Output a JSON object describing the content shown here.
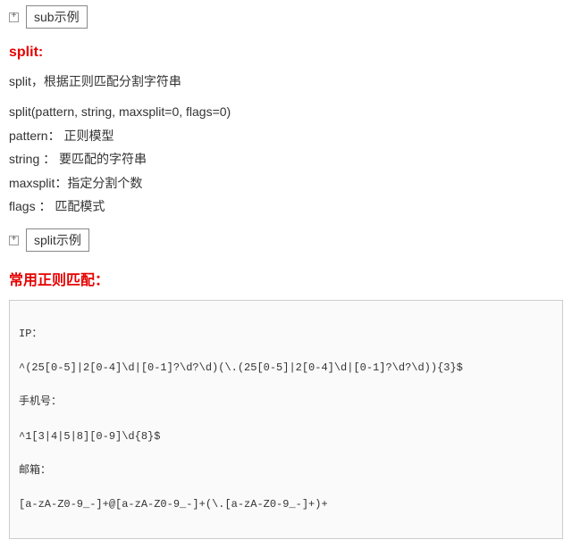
{
  "expand1": {
    "label": "sub示例"
  },
  "split": {
    "title": "split:",
    "desc": "split，根据正则匹配分割字符串",
    "signature": "split(pattern, string, maxsplit=0, flags=0)",
    "params": [
      "pattern： 正则模型",
      "string ： 要匹配的字符串",
      "maxsplit：指定分割个数",
      "flags  ： 匹配模式"
    ]
  },
  "expand2": {
    "label": "split示例"
  },
  "common": {
    "title": "常用正则匹配：",
    "lines": [
      "IP：",
      "^(25[0-5]|2[0-4]\\d|[0-1]?\\d?\\d)(\\.(25[0-5]|2[0-4]\\d|[0-1]?\\d?\\d)){3}$",
      "手机号：",
      "^1[3|4|5|8][0-9]\\d{8}$",
      "邮箱：",
      "[a-zA-Z0-9_-]+@[a-zA-Z0-9_-]+(\\.[a-zA-Z0-9_-]+)+"
    ]
  }
}
